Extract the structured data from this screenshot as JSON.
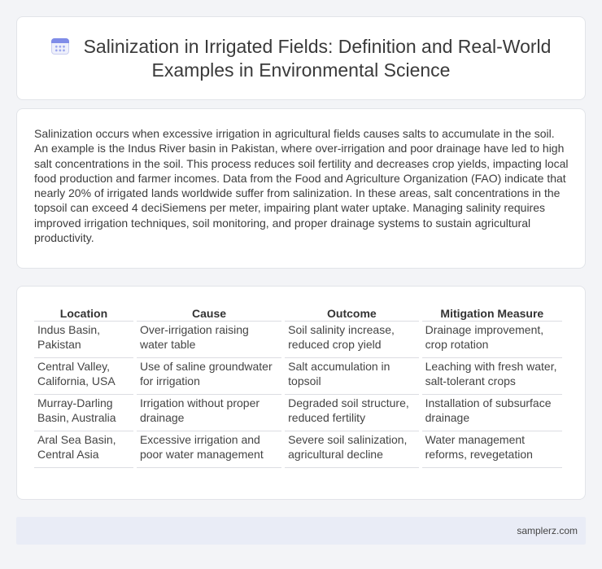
{
  "header": {
    "icon": "calendar-icon",
    "title_line1": "Salinization in Irrigated Fields: Definition and Real-World",
    "title_line2": "Examples in Environmental Science"
  },
  "paragraph": "Salinization occurs when excessive irrigation in agricultural fields causes salts to accumulate in the soil. An example is the Indus River basin in Pakistan, where over-irrigation and poor drainage have led to high salt concentrations in the soil. This process reduces soil fertility and decreases crop yields, impacting local food production and farmer incomes. Data from the Food and Agriculture Organization (FAO) indicate that nearly 20% of irrigated lands worldwide suffer from salinization. In these areas, salt concentrations in the topsoil can exceed 4 deciSiemens per meter, impairing plant water uptake. Managing salinity requires improved irrigation techniques, soil monitoring, and proper drainage systems to sustain agricultural productivity.",
  "table": {
    "headers": [
      "Location",
      "Cause",
      "Outcome",
      "Mitigation Measure"
    ],
    "rows": [
      [
        "Indus Basin, Pakistan",
        "Over-irrigation raising water table",
        "Soil salinity increase, reduced crop yield",
        "Drainage improvement, crop rotation"
      ],
      [
        "Central Valley, California, USA",
        "Use of saline groundwater for irrigation",
        "Salt accumulation in topsoil",
        "Leaching with fresh water, salt-tolerant crops"
      ],
      [
        "Murray-Darling Basin, Australia",
        "Irrigation without proper drainage",
        "Degraded soil structure, reduced fertility",
        "Installation of subsurface drainage"
      ],
      [
        "Aral Sea Basin, Central Asia",
        "Excessive irrigation and poor water management",
        "Severe soil salinization, agricultural decline",
        "Water management reforms, revegetation"
      ]
    ]
  },
  "footer": {
    "text": "samplerz.com"
  }
}
